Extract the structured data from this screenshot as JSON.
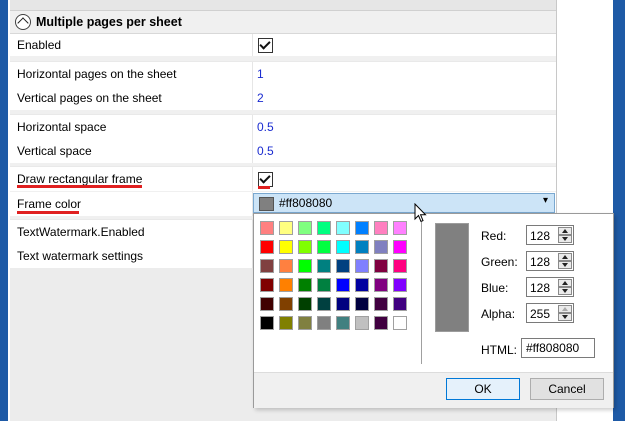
{
  "section": {
    "title": "Multiple pages per sheet"
  },
  "rows": {
    "enabled": {
      "label": "Enabled",
      "checked": true
    },
    "horizontal_pages": {
      "label": "Horizontal pages on the sheet",
      "value": "1"
    },
    "vertical_pages": {
      "label": "Vertical pages on the sheet",
      "value": "2"
    },
    "horizontal_space": {
      "label": "Horizontal space",
      "value": "0.5"
    },
    "vertical_space": {
      "label": "Vertical space",
      "value": "0.5"
    },
    "draw_frame": {
      "label": "Draw rectangular frame",
      "checked": true
    },
    "frame_color": {
      "label": "Frame color",
      "value": "#ff808080"
    },
    "textwatermark_enabled": {
      "label": "TextWatermark.Enabled"
    },
    "text_watermark_settings": {
      "label": "Text watermark settings"
    }
  },
  "color_picker": {
    "palette": [
      [
        "#ff8080",
        "#ffff80",
        "#80ff80",
        "#00ff80",
        "#80ffff",
        "#0080ff",
        "#ff80c0",
        "#ff80ff"
      ],
      [
        "#ff0000",
        "#ffff00",
        "#80ff00",
        "#00ff40",
        "#00ffff",
        "#0080c0",
        "#8080c0",
        "#ff00ff"
      ],
      [
        "#804040",
        "#ff8040",
        "#00ff00",
        "#008080",
        "#004080",
        "#8080ff",
        "#800040",
        "#ff0080"
      ],
      [
        "#800000",
        "#ff8000",
        "#008000",
        "#008040",
        "#0000ff",
        "#0000a0",
        "#800080",
        "#8000ff"
      ],
      [
        "#400000",
        "#804000",
        "#004000",
        "#004040",
        "#000080",
        "#000040",
        "#400040",
        "#400080"
      ],
      [
        "#000000",
        "#808000",
        "#808040",
        "#808080",
        "#408080",
        "#c0c0c0",
        "#400040",
        "#ffffff"
      ]
    ],
    "preview_color": "#808080",
    "red": {
      "label": "Red:",
      "value": "128"
    },
    "green": {
      "label": "Green:",
      "value": "128"
    },
    "blue": {
      "label": "Blue:",
      "value": "128"
    },
    "alpha": {
      "label": "Alpha:",
      "value": "255"
    },
    "html": {
      "label": "HTML:",
      "value": "#ff808080"
    },
    "ok_label": "OK",
    "cancel_label": "Cancel"
  }
}
